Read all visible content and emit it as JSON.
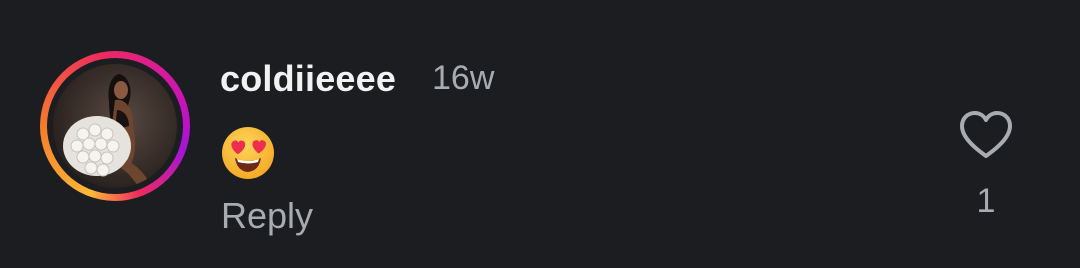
{
  "comment": {
    "username": "coldiieeee",
    "timestamp": "16w",
    "text_emoji": "😍",
    "reply_label": "Reply",
    "like_count": "1"
  },
  "icons": {
    "like": "heart-outline-icon",
    "emoji": "heart-eyes-emoji-icon"
  },
  "colors": {
    "background": "#1b1d20",
    "username": "#f2f2f2",
    "muted_text": "#a8abb0",
    "story_ring": [
      "#fdb836",
      "#f57b2c",
      "#ee2a5e",
      "#c913b9"
    ]
  }
}
